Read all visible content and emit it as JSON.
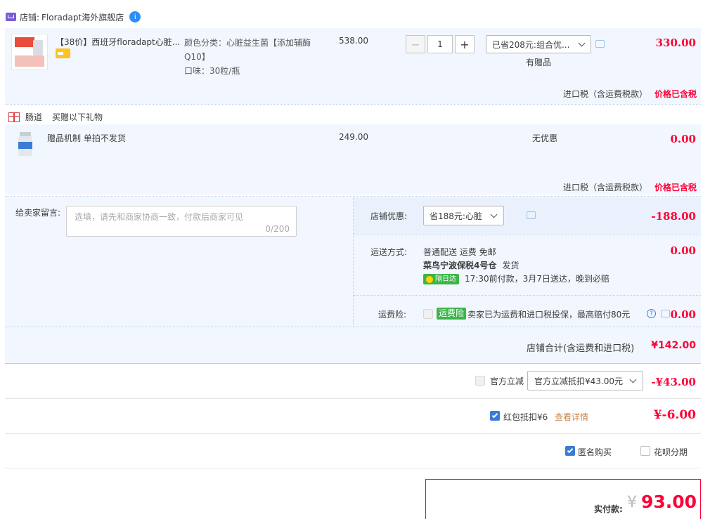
{
  "shop": {
    "label_prefix": "店铺:",
    "name": "Floradapt海外旗舰店",
    "badge": "i"
  },
  "item": {
    "title": "【38价】西班牙floradapt心脏...",
    "sku_line1": "颜色分类：心脏益生菌【添加辅酶",
    "sku_line2": "Q10】",
    "taste": "口味：30粒/瓶",
    "unit_price": "538.00",
    "qty": "1",
    "minus": "−",
    "plus": "+",
    "promo_select": "已省208元:组合优...",
    "gift_note": "有赠品",
    "subtotal": "330.00",
    "tax_label": "进口税（含运费税款）",
    "tax_value": "价格已含税"
  },
  "gift_section": {
    "title": "肠道",
    "subtitle": "买赠以下礼物",
    "item_name": "赠品机制 单拍不发货",
    "unit_price": "249.00",
    "discount": "无优惠",
    "subtotal": "0.00",
    "tax_label": "进口税（含运费税款）",
    "tax_value": "价格已含税"
  },
  "message": {
    "label": "给卖家留言:",
    "placeholder": "选填，请先和商家协商一致，付款后商家可见",
    "counter": "0/200"
  },
  "shop_discount": {
    "label": "店铺优惠:",
    "select": "省188元:心脏",
    "value": "-188.00"
  },
  "shipping": {
    "label": "运送方式:",
    "line1": "普通配送 运费 免邮",
    "warehouse": "菜鸟宁波保税4号仓",
    "ship_word": "发货",
    "badge": "隔日达",
    "promise": "17:30前付款，3月7日送达，晚到必赔",
    "value": "0.00"
  },
  "insurance": {
    "label": "运费险:",
    "badge": "运费险",
    "text": "卖家已为运费和进口税投保，最高赔付80元",
    "value": "0.00"
  },
  "shop_total": {
    "label": "店铺合计(含运费和进口税)",
    "value": "¥142.00"
  },
  "official": {
    "label": "官方立减",
    "select": "官方立减抵扣¥43.00元",
    "value": "-¥43.00"
  },
  "redpacket": {
    "label": "红包抵扣¥6",
    "link": "查看详情",
    "value": "¥-6.00"
  },
  "options": {
    "anonymous": "匿名购买",
    "huabei": "花呗分期"
  },
  "payable": {
    "label": "实付款:",
    "currency": "¥",
    "amount": "93.00"
  },
  "colors": {
    "accent_red": "#ff0036",
    "accent_blue": "#3a7bd5",
    "panel_bg": "#f2f7ff",
    "green_badge": "#3bb548"
  }
}
